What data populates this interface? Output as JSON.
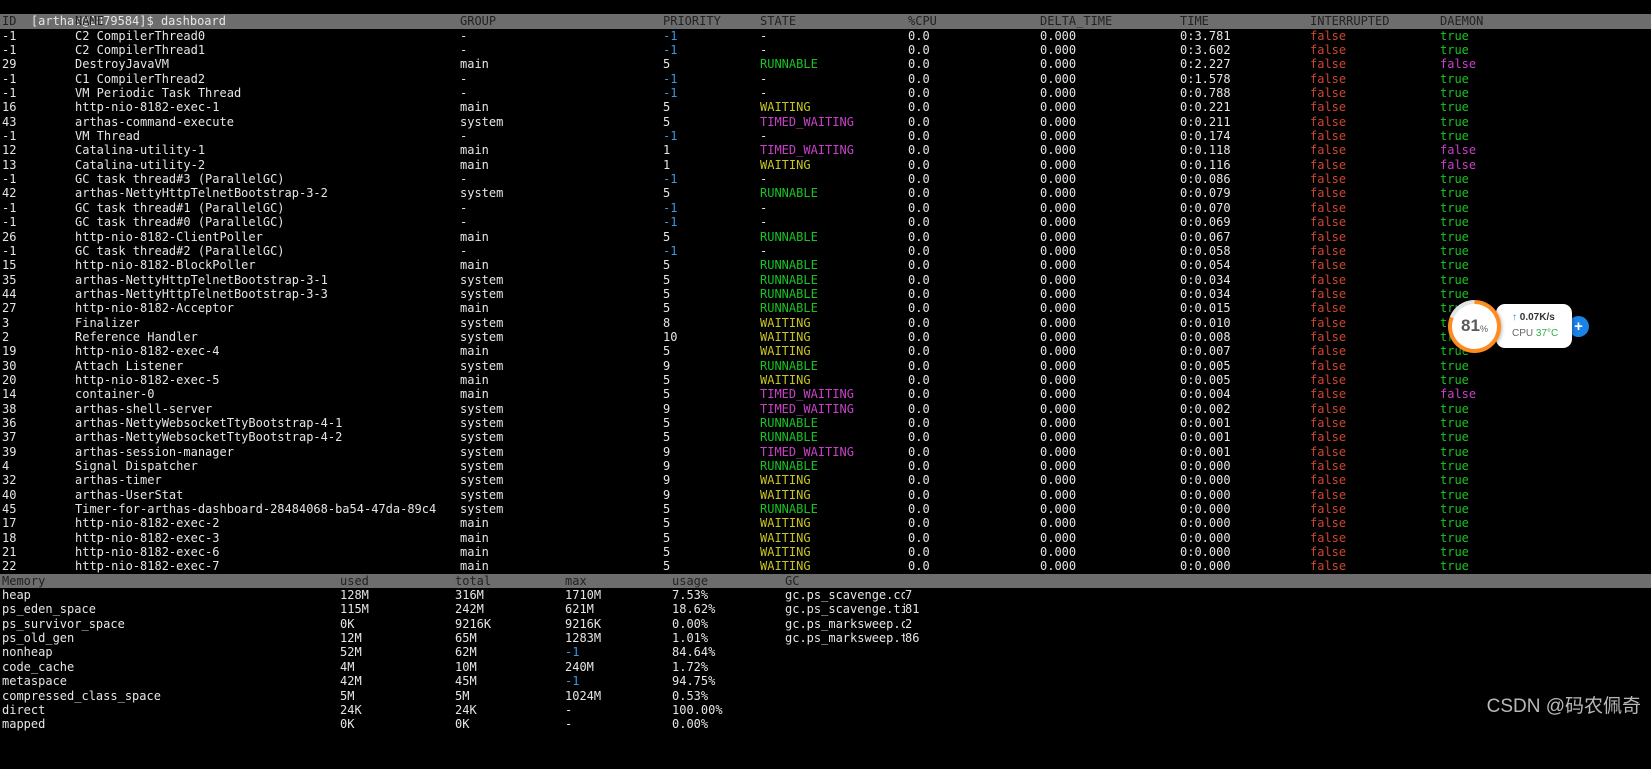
{
  "colors": {
    "background": "#000000",
    "text": "#e6e6e6",
    "header_bg": "#6d6d6d",
    "header_text": "#222222",
    "green": "#18c324",
    "yellow": "#c8c523",
    "magenta": "#c840c8",
    "red": "#cd4631",
    "cyan": "#3a96dd",
    "widget_orange": "#ff8a1e",
    "widget_blue": "#1b82e8",
    "widget_green": "#2fae4c"
  },
  "terminal": {
    "prompt": "[arthas@2879584]$ dashboard"
  },
  "thread_table": {
    "headers": [
      "ID",
      "NAME",
      "GROUP",
      "PRIORITY",
      "STATE",
      "%CPU",
      "DELTA_TIME",
      "TIME",
      "INTERRUPTED",
      "DAEMON"
    ],
    "rows": [
      [
        "-1",
        "C2 CompilerThread0",
        "-",
        "-1",
        "-",
        "0.0",
        "0.000",
        "0:3.781",
        "false",
        "true"
      ],
      [
        "-1",
        "C2 CompilerThread1",
        "-",
        "-1",
        "-",
        "0.0",
        "0.000",
        "0:3.602",
        "false",
        "true"
      ],
      [
        "29",
        "DestroyJavaVM",
        "main",
        "5",
        "RUNNABLE",
        "0.0",
        "0.000",
        "0:2.227",
        "false",
        "false"
      ],
      [
        "-1",
        "C1 CompilerThread2",
        "-",
        "-1",
        "-",
        "0.0",
        "0.000",
        "0:1.578",
        "false",
        "true"
      ],
      [
        "-1",
        "VM Periodic Task Thread",
        "-",
        "-1",
        "-",
        "0.0",
        "0.000",
        "0:0.788",
        "false",
        "true"
      ],
      [
        "16",
        "http-nio-8182-exec-1",
        "main",
        "5",
        "WAITING",
        "0.0",
        "0.000",
        "0:0.221",
        "false",
        "true"
      ],
      [
        "43",
        "arthas-command-execute",
        "system",
        "5",
        "TIMED_WAITING",
        "0.0",
        "0.000",
        "0:0.211",
        "false",
        "true"
      ],
      [
        "-1",
        "VM Thread",
        "-",
        "-1",
        "-",
        "0.0",
        "0.000",
        "0:0.174",
        "false",
        "true"
      ],
      [
        "12",
        "Catalina-utility-1",
        "main",
        "1",
        "TIMED_WAITING",
        "0.0",
        "0.000",
        "0:0.118",
        "false",
        "false"
      ],
      [
        "13",
        "Catalina-utility-2",
        "main",
        "1",
        "WAITING",
        "0.0",
        "0.000",
        "0:0.116",
        "false",
        "false"
      ],
      [
        "-1",
        "GC task thread#3 (ParallelGC)",
        "-",
        "-1",
        "-",
        "0.0",
        "0.000",
        "0:0.086",
        "false",
        "true"
      ],
      [
        "42",
        "arthas-NettyHttpTelnetBootstrap-3-2",
        "system",
        "5",
        "RUNNABLE",
        "0.0",
        "0.000",
        "0:0.079",
        "false",
        "true"
      ],
      [
        "-1",
        "GC task thread#1 (ParallelGC)",
        "-",
        "-1",
        "-",
        "0.0",
        "0.000",
        "0:0.070",
        "false",
        "true"
      ],
      [
        "-1",
        "GC task thread#0 (ParallelGC)",
        "-",
        "-1",
        "-",
        "0.0",
        "0.000",
        "0:0.069",
        "false",
        "true"
      ],
      [
        "26",
        "http-nio-8182-ClientPoller",
        "main",
        "5",
        "RUNNABLE",
        "0.0",
        "0.000",
        "0:0.067",
        "false",
        "true"
      ],
      [
        "-1",
        "GC task thread#2 (ParallelGC)",
        "-",
        "-1",
        "-",
        "0.0",
        "0.000",
        "0:0.058",
        "false",
        "true"
      ],
      [
        "15",
        "http-nio-8182-BlockPoller",
        "main",
        "5",
        "RUNNABLE",
        "0.0",
        "0.000",
        "0:0.054",
        "false",
        "true"
      ],
      [
        "35",
        "arthas-NettyHttpTelnetBootstrap-3-1",
        "system",
        "5",
        "RUNNABLE",
        "0.0",
        "0.000",
        "0:0.034",
        "false",
        "true"
      ],
      [
        "44",
        "arthas-NettyHttpTelnetBootstrap-3-3",
        "system",
        "5",
        "RUNNABLE",
        "0.0",
        "0.000",
        "0:0.034",
        "false",
        "true"
      ],
      [
        "27",
        "http-nio-8182-Acceptor",
        "main",
        "5",
        "RUNNABLE",
        "0.0",
        "0.000",
        "0:0.015",
        "false",
        "true"
      ],
      [
        "3",
        "Finalizer",
        "system",
        "8",
        "WAITING",
        "0.0",
        "0.000",
        "0:0.010",
        "false",
        "true"
      ],
      [
        "2",
        "Reference Handler",
        "system",
        "10",
        "WAITING",
        "0.0",
        "0.000",
        "0:0.008",
        "false",
        "true"
      ],
      [
        "19",
        "http-nio-8182-exec-4",
        "main",
        "5",
        "WAITING",
        "0.0",
        "0.000",
        "0:0.007",
        "false",
        "true"
      ],
      [
        "30",
        "Attach Listener",
        "system",
        "9",
        "RUNNABLE",
        "0.0",
        "0.000",
        "0:0.005",
        "false",
        "true"
      ],
      [
        "20",
        "http-nio-8182-exec-5",
        "main",
        "5",
        "WAITING",
        "0.0",
        "0.000",
        "0:0.005",
        "false",
        "true"
      ],
      [
        "14",
        "container-0",
        "main",
        "5",
        "TIMED_WAITING",
        "0.0",
        "0.000",
        "0:0.004",
        "false",
        "false"
      ],
      [
        "38",
        "arthas-shell-server",
        "system",
        "9",
        "TIMED_WAITING",
        "0.0",
        "0.000",
        "0:0.002",
        "false",
        "true"
      ],
      [
        "36",
        "arthas-NettyWebsocketTtyBootstrap-4-1",
        "system",
        "5",
        "RUNNABLE",
        "0.0",
        "0.000",
        "0:0.001",
        "false",
        "true"
      ],
      [
        "37",
        "arthas-NettyWebsocketTtyBootstrap-4-2",
        "system",
        "5",
        "RUNNABLE",
        "0.0",
        "0.000",
        "0:0.001",
        "false",
        "true"
      ],
      [
        "39",
        "arthas-session-manager",
        "system",
        "9",
        "TIMED_WAITING",
        "0.0",
        "0.000",
        "0:0.001",
        "false",
        "true"
      ],
      [
        "4",
        "Signal Dispatcher",
        "system",
        "9",
        "RUNNABLE",
        "0.0",
        "0.000",
        "0:0.000",
        "false",
        "true"
      ],
      [
        "32",
        "arthas-timer",
        "system",
        "9",
        "WAITING",
        "0.0",
        "0.000",
        "0:0.000",
        "false",
        "true"
      ],
      [
        "40",
        "arthas-UserStat",
        "system",
        "9",
        "WAITING",
        "0.0",
        "0.000",
        "0:0.000",
        "false",
        "true"
      ],
      [
        "45",
        "Timer-for-arthas-dashboard-28484068-ba54-47da-89c4",
        "system",
        "5",
        "RUNNABLE",
        "0.0",
        "0.000",
        "0:0.000",
        "false",
        "true"
      ],
      [
        "17",
        "http-nio-8182-exec-2",
        "main",
        "5",
        "WAITING",
        "0.0",
        "0.000",
        "0:0.000",
        "false",
        "true"
      ],
      [
        "18",
        "http-nio-8182-exec-3",
        "main",
        "5",
        "WAITING",
        "0.0",
        "0.000",
        "0:0.000",
        "false",
        "true"
      ],
      [
        "21",
        "http-nio-8182-exec-6",
        "main",
        "5",
        "WAITING",
        "0.0",
        "0.000",
        "0:0.000",
        "false",
        "true"
      ],
      [
        "22",
        "http-nio-8182-exec-7",
        "main",
        "5",
        "WAITING",
        "0.0",
        "0.000",
        "0:0.000",
        "false",
        "true"
      ]
    ]
  },
  "memory_table": {
    "headers": [
      "Memory",
      "used",
      "total",
      "max",
      "usage",
      "GC"
    ],
    "rows": [
      [
        "heap",
        "128M",
        "316M",
        "1710M",
        "7.53%",
        "gc.ps_scavenge.count",
        "7"
      ],
      [
        "ps_eden_space",
        "115M",
        "242M",
        "621M",
        "18.62%",
        "gc.ps_scavenge.time(ms)",
        "81"
      ],
      [
        "ps_survivor_space",
        "0K",
        "9216K",
        "9216K",
        "0.00%",
        "gc.ps_marksweep.count",
        "2"
      ],
      [
        "ps_old_gen",
        "12M",
        "65M",
        "1283M",
        "1.01%",
        "gc.ps_marksweep.time(ms)",
        "86"
      ],
      [
        "nonheap",
        "52M",
        "62M",
        "-1",
        "84.64%",
        "",
        ""
      ],
      [
        "code_cache",
        "4M",
        "10M",
        "240M",
        "1.72%",
        "",
        ""
      ],
      [
        "metaspace",
        "42M",
        "45M",
        "-1",
        "94.75%",
        "",
        ""
      ],
      [
        "compressed_class_space",
        "5M",
        "5M",
        "1024M",
        "0.53%",
        "",
        ""
      ],
      [
        "direct",
        "24K",
        "24K",
        "-",
        "100.00%",
        "",
        ""
      ],
      [
        "mapped",
        "0K",
        "0K",
        "-",
        "0.00%",
        "",
        ""
      ]
    ]
  },
  "widget": {
    "percent": "81",
    "percent_sign": "%",
    "arrow": "↑",
    "net_speed": "0.07K/s",
    "cpu_label": "CPU",
    "cpu_temp": "37°C",
    "plus": "+"
  },
  "watermark": {
    "text": "CSDN @码农佩奇"
  }
}
